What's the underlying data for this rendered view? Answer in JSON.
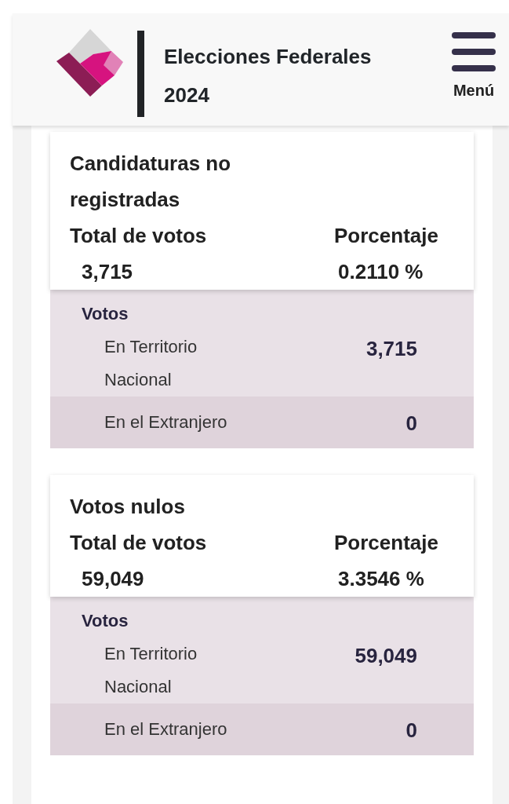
{
  "header": {
    "title": "Elecciones Federales 2024",
    "menu_label": "Menú"
  },
  "cards": [
    {
      "title": "Candidaturas no registradas",
      "total_label": "Total de votos",
      "total": "3,715",
      "percent_label": "Porcentaje",
      "percent": "0.2110 %",
      "breakdown_title": "Votos",
      "rows": [
        {
          "label": "En Territorio Nacional",
          "value": "3,715"
        },
        {
          "label": "En el Extranjero",
          "value": "0"
        }
      ]
    },
    {
      "title": "Votos nulos",
      "total_label": "Total de votos",
      "total": "59,049",
      "percent_label": "Porcentaje",
      "percent": "3.3546 %",
      "breakdown_title": "Votos",
      "rows": [
        {
          "label": "En Territorio Nacional",
          "value": "59,049"
        },
        {
          "label": "En el Extranjero",
          "value": "0"
        }
      ]
    }
  ]
}
